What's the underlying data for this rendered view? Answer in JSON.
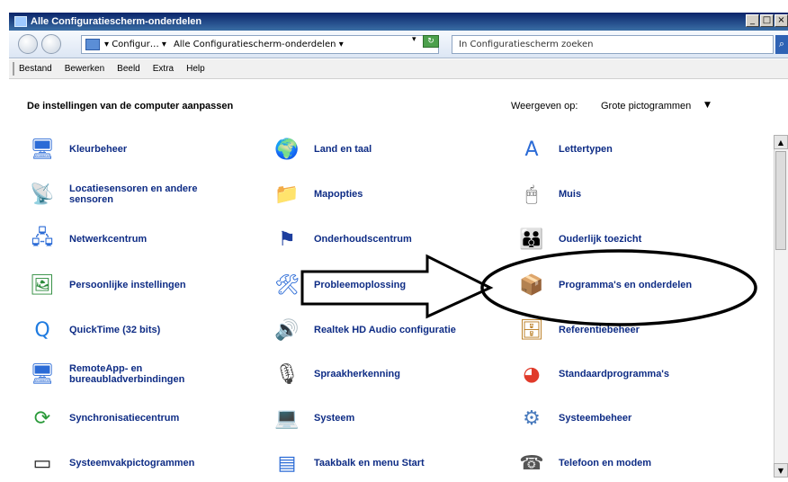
{
  "window": {
    "title": "Alle Configuratiescherm-onderdelen",
    "buttons": [
      "_",
      "□",
      "×"
    ]
  },
  "address": {
    "segments": [
      "▾ Configur… ▾",
      "Alle Configuratiescherm-onderdelen ▾"
    ],
    "dropdown": "▾",
    "search_placeholder": "In Configuratiescherm zoeken"
  },
  "menu": [
    "Bestand",
    "Bewerken",
    "Beeld",
    "Extra",
    "Help"
  ],
  "main": {
    "heading": "De instellingen van de computer aanpassen",
    "view_label": "Weergeven op:",
    "view_value": "Grote pictogrammen",
    "view_arrow": "▼"
  },
  "items": [
    {
      "label": "Kleurbeheer",
      "icon": "monitor-color-icon",
      "glyph": "🖥"
    },
    {
      "label": "Land en taal",
      "icon": "globe-clock-icon",
      "glyph": "🌍"
    },
    {
      "label": "Lettertypen",
      "icon": "font-folder-icon",
      "glyph": "A"
    },
    {
      "label": "Locatiesensoren en andere sensoren",
      "icon": "sensor-icon",
      "glyph": "📡"
    },
    {
      "label": "Mapopties",
      "icon": "folder-options-icon",
      "glyph": "📁"
    },
    {
      "label": "Muis",
      "icon": "mouse-icon",
      "glyph": "🖱"
    },
    {
      "label": "Netwerkcentrum",
      "icon": "network-icon",
      "glyph": "🖧"
    },
    {
      "label": "Onderhoudscentrum",
      "icon": "flag-icon",
      "glyph": "⚑"
    },
    {
      "label": "Ouderlijk toezicht",
      "icon": "parental-control-icon",
      "glyph": "👪"
    },
    {
      "label": "Persoonlijke instellingen",
      "icon": "personalization-icon",
      "glyph": "🖼"
    },
    {
      "label": "Probleemoplossing",
      "icon": "troubleshooting-icon",
      "glyph": "🛠"
    },
    {
      "label": "Programma's en onderdelen",
      "icon": "programs-icon",
      "glyph": "📦"
    },
    {
      "label": "QuickTime (32 bits)",
      "icon": "quicktime-icon",
      "glyph": "Q"
    },
    {
      "label": "Realtek HD Audio configuratie",
      "icon": "audio-icon",
      "glyph": "🔊"
    },
    {
      "label": "Referentiebeheer",
      "icon": "credential-manager-icon",
      "glyph": "🗄"
    },
    {
      "label": "RemoteApp- en bureaubladverbindingen",
      "icon": "remote-desktop-icon",
      "glyph": "🖥"
    },
    {
      "label": "Spraakherkenning",
      "icon": "microphone-icon",
      "glyph": "🎙"
    },
    {
      "label": "Standaardprogramma's",
      "icon": "default-programs-icon",
      "glyph": "◕"
    },
    {
      "label": "Synchronisatiecentrum",
      "icon": "sync-center-icon",
      "glyph": "⟳"
    },
    {
      "label": "Systeem",
      "icon": "system-icon",
      "glyph": "💻"
    },
    {
      "label": "Systeembeheer",
      "icon": "admin-tools-icon",
      "glyph": "⚙"
    },
    {
      "label": "Systeemvakpictogrammen",
      "icon": "tray-icons-icon",
      "glyph": "▭"
    },
    {
      "label": "Taakbalk en menu Start",
      "icon": "taskbar-icon",
      "glyph": "▤"
    },
    {
      "label": "Telefoon en modem",
      "icon": "phone-modem-icon",
      "glyph": "☎"
    }
  ],
  "colors": {
    "link": "#0e2c85",
    "titlebar": "#0a246a"
  }
}
